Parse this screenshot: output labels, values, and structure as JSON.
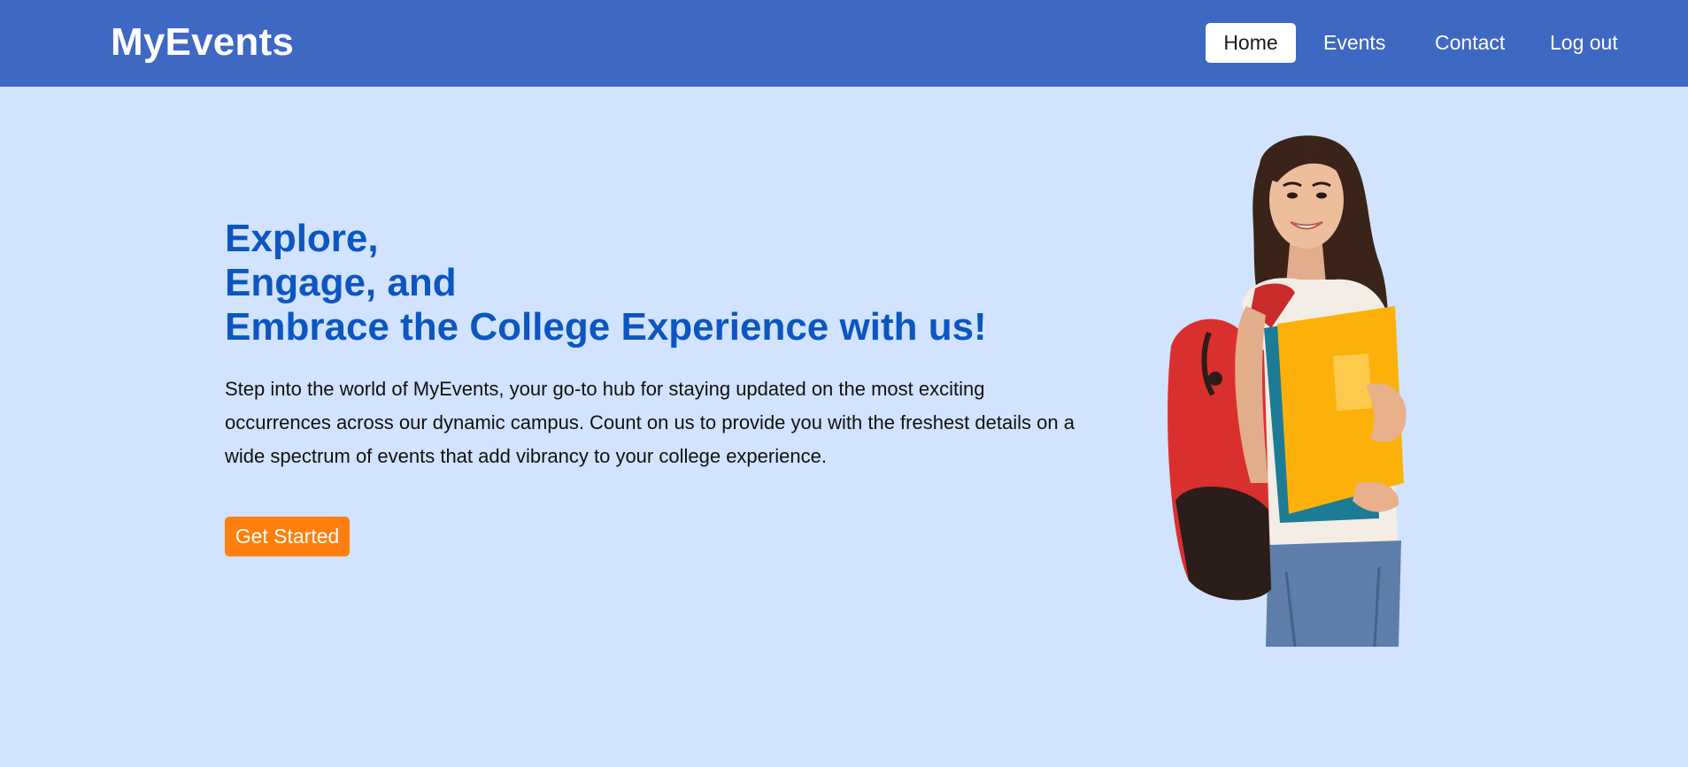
{
  "navbar": {
    "brand": "MyEvents",
    "links": [
      {
        "label": "Home",
        "active": true
      },
      {
        "label": "Events",
        "active": false
      },
      {
        "label": "Contact",
        "active": false
      },
      {
        "label": "Log out",
        "active": false
      }
    ]
  },
  "hero": {
    "title_lines": [
      "Explore,",
      "Engage, and",
      "Embrace the College Experience with us!"
    ],
    "description": "Step into the world of MyEvents, your go-to hub for staying updated on the most exciting occurrences across our dynamic campus. Count on us to provide you with the freshest details on a wide spectrum of events that add vibrancy to your college experience.",
    "cta_label": "Get Started",
    "image_subject": "student-with-backpack-and-folders"
  },
  "colors": {
    "navbar_bg": "#3e68c2",
    "page_bg": "#d1e3fe",
    "title": "#0c56c0",
    "cta_bg": "#ff7f0e"
  }
}
